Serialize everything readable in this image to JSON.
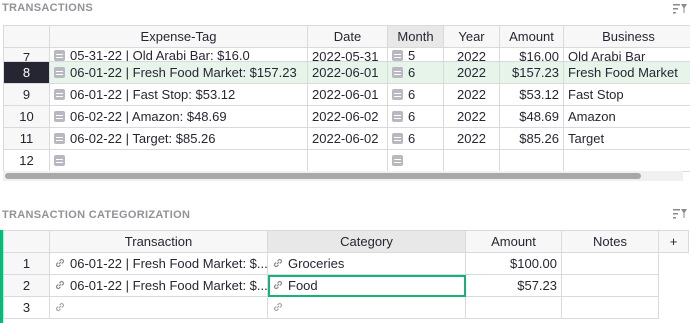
{
  "sections": {
    "transactions_title": "TRANSACTIONS",
    "categorization_title": "TRANSACTION CATEGORIZATION"
  },
  "transactions": {
    "columns": [
      "Expense-Tag",
      "Date",
      "Month",
      "Year",
      "Amount",
      "Business"
    ],
    "partial_row": {
      "num": "7",
      "tag": "05-31-22 | Old Arabi Bar: $16.0",
      "date": "2022-05-31",
      "month": "5",
      "year": "2022",
      "amount": "$16.00",
      "business": "Old Arabi Bar"
    },
    "rows": [
      {
        "num": "8",
        "tag": "06-01-22 | Fresh Food Market: $157.23",
        "date": "2022-06-01",
        "month": "6",
        "year": "2022",
        "amount": "$157.23",
        "business": "Fresh Food Market"
      },
      {
        "num": "9",
        "tag": "06-01-22 | Fast Stop: $53.12",
        "date": "2022-06-01",
        "month": "6",
        "year": "2022",
        "amount": "$53.12",
        "business": "Fast Stop"
      },
      {
        "num": "10",
        "tag": "06-02-22 | Amazon: $48.69",
        "date": "2022-06-02",
        "month": "6",
        "year": "2022",
        "amount": "$48.69",
        "business": "Amazon"
      },
      {
        "num": "11",
        "tag": "06-02-22 | Target: $85.26",
        "date": "2022-06-02",
        "month": "6",
        "year": "2022",
        "amount": "$85.26",
        "business": "Target"
      }
    ],
    "new_row_num": "12"
  },
  "categorization": {
    "columns": [
      "Transaction",
      "Category",
      "Amount",
      "Notes"
    ],
    "add_column": "+",
    "rows": [
      {
        "num": "1",
        "transaction": "06-01-22 | Fresh Food Market: $...",
        "category": "Groceries",
        "amount": "$100.00",
        "notes": ""
      },
      {
        "num": "2",
        "transaction": "06-01-22 | Fresh Food Market: $...",
        "category": "Food",
        "amount": "$57.23",
        "notes": ""
      }
    ],
    "new_row_num": "3"
  },
  "colors": {
    "accent": "#16b378",
    "active_row": "#e6f4ea",
    "row_num_active": "#262633"
  },
  "icons": [
    "sort-filter-icon",
    "choice-chip-icon",
    "reference-link-icon"
  ]
}
